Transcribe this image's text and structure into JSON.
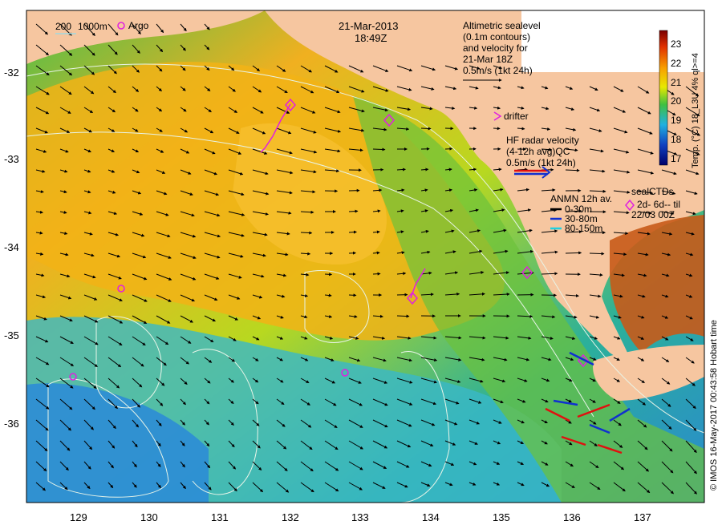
{
  "header": {
    "date": "21-Mar-2013",
    "time": "18:49Z"
  },
  "scale_bar": {
    "label_200": "200",
    "label_1000": "1000m"
  },
  "argo": {
    "label": "Argo"
  },
  "altimetry": {
    "lines": [
      "Altimetric sealevel",
      "(0.1m contours)",
      "and velocity for",
      "21-Mar 18Z",
      "0.5m/s (1kt 24h)"
    ]
  },
  "drifter": {
    "label": "drifter"
  },
  "hf_radar": {
    "lines": [
      "HF radar velocity",
      "(4-12h avg)QC",
      "0.5m/s (1kt 24h)"
    ]
  },
  "anmn": {
    "title": "ANMN 12h av.",
    "entries": [
      {
        "label": "0-30m",
        "color": "#000000"
      },
      {
        "label": "30-80m",
        "color": "#1030d0"
      },
      {
        "label": "80-150m",
        "color": "#20d0e0"
      }
    ]
  },
  "seal_ctd": {
    "lines": [
      "sealCTDs",
      "2d- 6d-- til",
      "22/03 00Z"
    ]
  },
  "colorbar": {
    "title": "Temp. (°C) 18_L3U 4% ql>=4",
    "ticks": [
      "23",
      "22",
      "21",
      "20",
      "19",
      "18",
      "17"
    ]
  },
  "axes": {
    "y_ticks": [
      "-32",
      "-33",
      "-34",
      "-35",
      "-36"
    ],
    "x_ticks": [
      "129",
      "130",
      "131",
      "132",
      "133",
      "134",
      "135",
      "136",
      "137"
    ]
  },
  "credit": "© IMOS 16-May-2017 00:43:58 Hobart time",
  "colors": {
    "land": "#f6c6a0",
    "sst_warm": "#f5a800",
    "sst_mid": "#9bd21e",
    "sst_cool": "#2aa9d8",
    "drifter": "#e020e0",
    "hf_red": "#e01010",
    "hf_blue": "#1030d0"
  }
}
